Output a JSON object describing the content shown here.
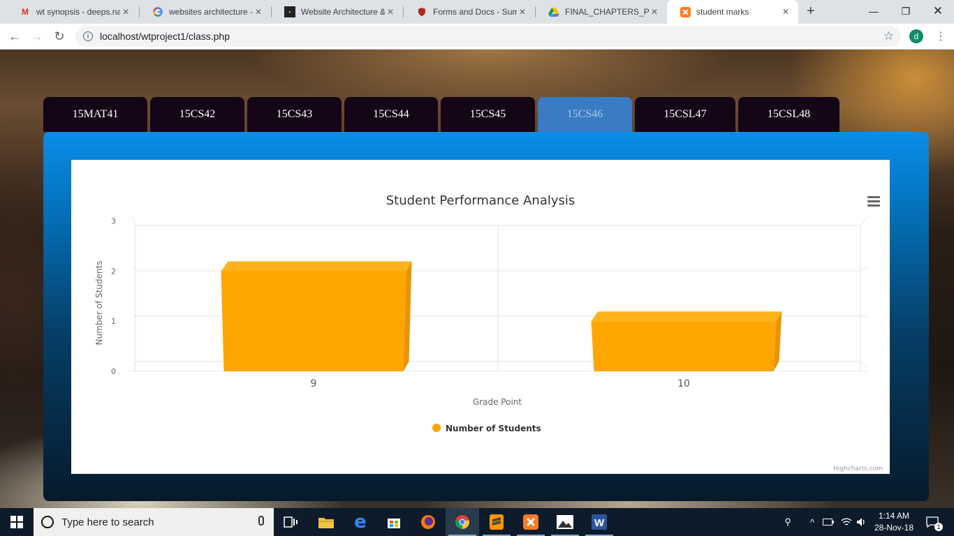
{
  "browser": {
    "tabs": [
      {
        "title": "wt synopsis - deeps.nag",
        "icon": "gmail-icon"
      },
      {
        "title": "websites architecture - G",
        "icon": "google-icon"
      },
      {
        "title": "Website Architecture &",
        "icon": "site-icon"
      },
      {
        "title": "Forms and Docs - Suma",
        "icon": "shield-icon"
      },
      {
        "title": "FINAL_CHAPTERS_PAGE",
        "icon": "drive-icon"
      },
      {
        "title": "student marks",
        "icon": "xampp-icon",
        "active": true
      }
    ],
    "url": "localhost/wtproject1/class.php",
    "profile_initial": "d"
  },
  "course_tabs": [
    {
      "label": "15MAT41"
    },
    {
      "label": "15CS42"
    },
    {
      "label": "15CS43"
    },
    {
      "label": "15CS44"
    },
    {
      "label": "15CS45"
    },
    {
      "label": "15CS46",
      "active": true
    },
    {
      "label": "15CSL47"
    },
    {
      "label": "15CSL48"
    }
  ],
  "chart_data": {
    "type": "bar",
    "title": "Student Performance Analysis",
    "xlabel": "Grade Point",
    "ylabel": "Number of Students",
    "categories": [
      "9",
      "10"
    ],
    "series": [
      {
        "name": "Number of Students",
        "values": [
          2,
          1
        ],
        "color": "#FFA500"
      }
    ],
    "ylim": [
      0,
      3
    ],
    "yticks": [
      "0",
      "1",
      "2",
      "3"
    ],
    "grid": true,
    "style": "3d",
    "legend": "bottom",
    "credits": "Highcharts.com"
  },
  "taskbar": {
    "search_placeholder": "Type here to search",
    "time": "1:14 AM",
    "date": "28-Nov-18",
    "notification_count": "1"
  }
}
